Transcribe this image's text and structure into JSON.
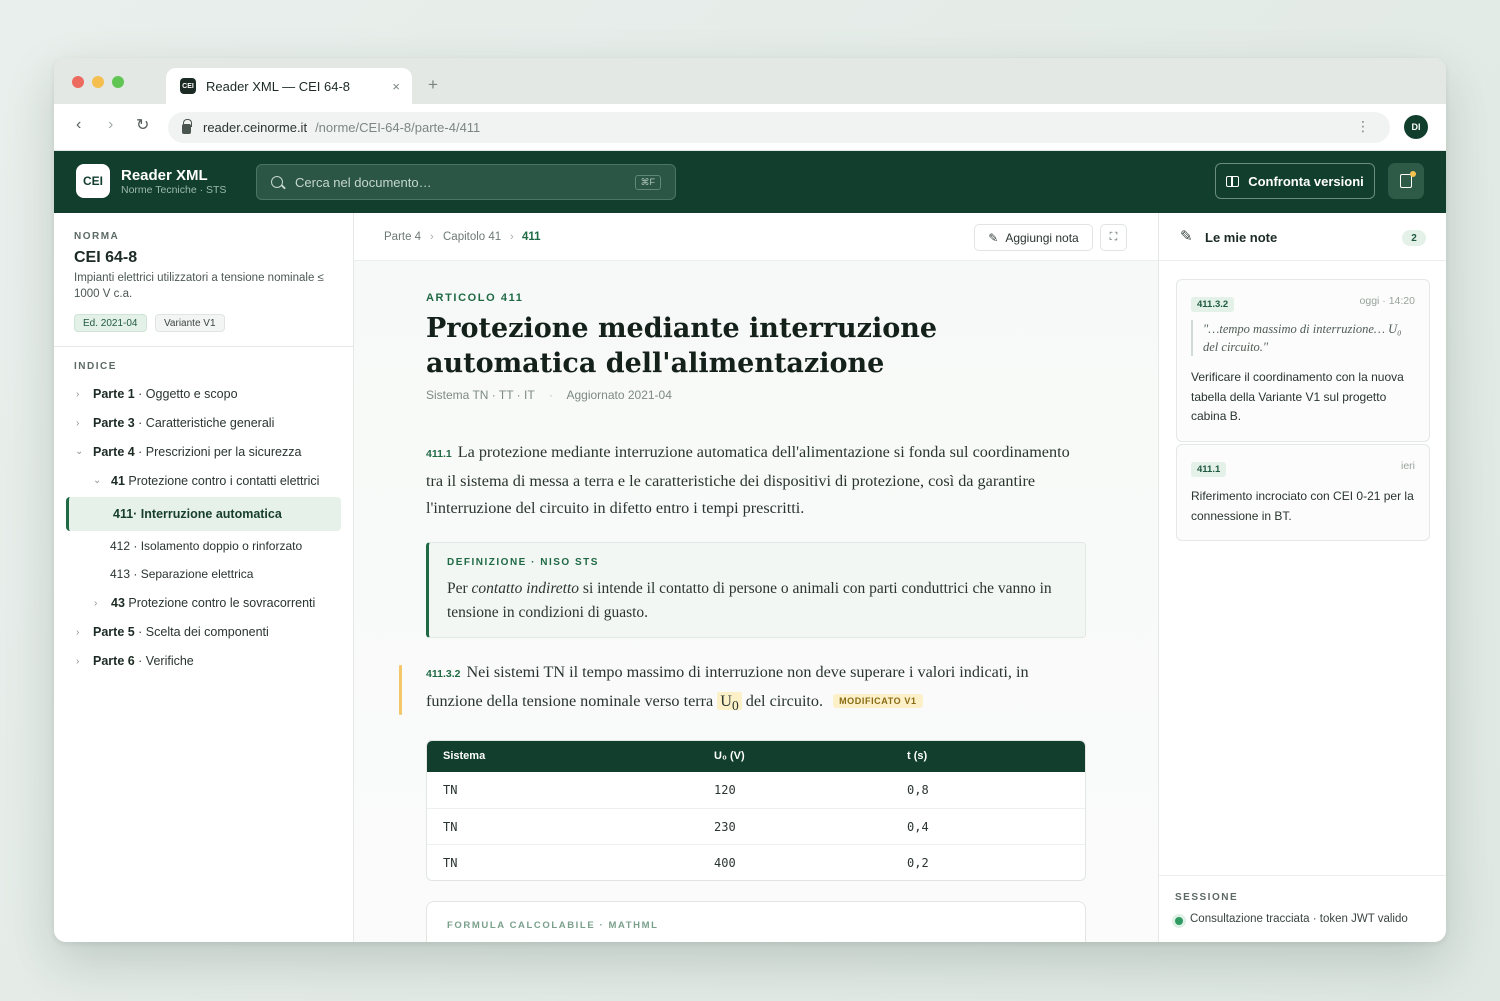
{
  "browser": {
    "tab_icon": "CEI",
    "tab_title": "Reader XML — CEI 64-8",
    "tab_close": "×",
    "new_tab": "+",
    "url_host": "reader.ceinorme.it",
    "url_path": "/norme/CEI-64-8/parte-4/411",
    "profile_initials": "DI"
  },
  "app": {
    "logo": "CEI",
    "title": "Reader XML",
    "subtitle": "Norme Tecniche · STS",
    "search_placeholder": "Cerca nel documento…",
    "search_shortcut": "⌘F",
    "compare_label": "Confronta versioni",
    "accent_color": "#123e2e"
  },
  "sidebar": {
    "norm_label": "NORMA",
    "norm_title": "CEI 64-8",
    "norm_desc": "Impianti elettrici utilizzatori a tensione nominale ≤ 1000 V c.a.",
    "edition": "Ed. 2021-04",
    "variant": "Variante V1",
    "index_label": "INDICE",
    "toc": [
      {
        "num": "Parte 1",
        "label": " · Oggetto e scopo"
      },
      {
        "num": "Parte 3",
        "label": " · Caratteristiche generali"
      },
      {
        "num": "Parte 4",
        "label": " · Prescrizioni per la sicurezza"
      },
      {
        "num": "41",
        "label": " Protezione contro i contatti elettrici"
      },
      {
        "num": "411",
        "label": " · Interruzione automatica"
      },
      {
        "num": "412",
        "label": " · Isolamento doppio o rinforzato"
      },
      {
        "num": "413",
        "label": " · Separazione elettrica"
      },
      {
        "num": "43",
        "label": " Protezione contro le sovracorrenti"
      },
      {
        "num": "Parte 5",
        "label": " · Scelta dei componenti"
      },
      {
        "num": "Parte 6",
        "label": " · Verifiche"
      }
    ]
  },
  "breadcrumb": [
    "Parte 4",
    "Capitolo 41",
    "411"
  ],
  "toolbar": {
    "add_note": "Aggiungi nota"
  },
  "article": {
    "kicker": "ARTICOLO 411",
    "title": "Protezione mediante interruzione automatica dell'alimentazione",
    "systems": "Sistema TN · TT · IT",
    "updated": "Aggiornato 2021-04",
    "p1_num": "411.1",
    "p1_text": "La protezione mediante interruzione automatica dell'alimentazione si fonda sul coordinamento tra il sistema di messa a terra e le caratteristiche dei dispositivi di protezione, così da garantire l'interruzione del circuito in difetto entro i tempi prescritti.",
    "def_label": "DEFINIZIONE · NISO STS",
    "def_pre": "Per ",
    "def_term": "contatto indiretto",
    "def_post": " si intende il contatto di persone o animali con parti conduttrici che vanno in tensione in condizioni di guasto.",
    "p2_num": "411.3.2",
    "p2_text_a": "Nei sistemi TN il tempo massimo di interruzione non deve superare i valori indicati, in funzione della tensione nominale verso terra ",
    "p2_u": "U",
    "p2_sub": "0",
    "p2_text_b": " del circuito.",
    "mod_badge": "MODIFICATO V1",
    "table": {
      "headers": [
        "Sistema",
        "U₀ (V)",
        "t (s)"
      ],
      "rows": [
        [
          "TN",
          "120",
          "0,8"
        ],
        [
          "TN",
          "230",
          "0,4"
        ],
        [
          "TN",
          "400",
          "0,2"
        ]
      ]
    },
    "formula_label": "FORMULA CALCOLABILE · MATHML"
  },
  "notes_panel": {
    "title": "Le mie note",
    "count": "2",
    "notes": [
      {
        "ref": "411.3.2",
        "time": "oggi · 14:20",
        "quote": "\"…tempo massimo di interruzione… U₀ del circuito.\"",
        "text": "Verificare il coordinamento con la nuova tabella della Variante V1 sul progetto cabina B."
      },
      {
        "ref": "411.1",
        "time": "ieri",
        "text": "Riferimento incrociato con CEI 0-21 per la connessione in BT."
      }
    ],
    "session_label": "SESSIONE",
    "session_text": "Consultazione tracciata · token JWT valido"
  }
}
